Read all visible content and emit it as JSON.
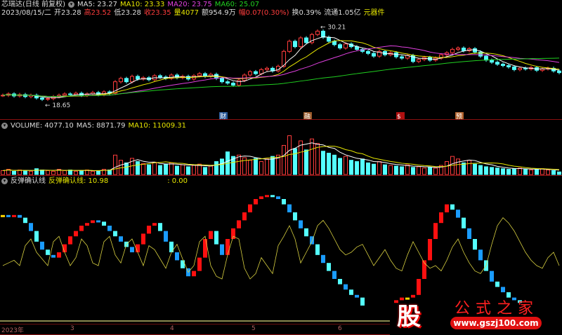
{
  "header": {
    "stock": "芯瑞达(日线 前复权)",
    "ma5": "MA5: 23.27",
    "ma10": "MA10: 23.33",
    "ma20": "MA20: 23.75",
    "ma60": "MA60: 25.07",
    "date": "2023/08/15/二",
    "open": "开23.28",
    "high": "高23.52",
    "low": "低23.28",
    "close": "收23.35",
    "volume": "量4077",
    "amount": "额954.9万",
    "change": "幅0.07(0.30%)",
    "turnover": "换0.39%",
    "float": "流通1.05亿",
    "sector": "元器件"
  },
  "price_labels": {
    "high_mark": "30.21",
    "low_mark": "18.65"
  },
  "event_markers": [
    "财",
    "融",
    "$",
    "预"
  ],
  "volume_header": {
    "volume": "VOLUME: 4077.10",
    "ma5": "MA5: 8871.79",
    "ma10": "MA10: 11009.31"
  },
  "indicator_header": {
    "name": "反弹确认线",
    "value": "反弹确认线: 10.98",
    "value2": ": 0.00"
  },
  "axis": {
    "labels": [
      "2023年",
      "3",
      "4",
      "5",
      "6"
    ]
  },
  "logo": {
    "char": "股",
    "title": "公式之家",
    "url": "www.gszj100.com"
  },
  "colors": {
    "up": "#ff3c3c",
    "down": "#54ffff",
    "ma5": "#ffffff",
    "ma10": "#e6e600",
    "ma20": "#e040e0",
    "ma60": "#20d020",
    "osc": "#d8d040"
  },
  "chart_data": {
    "type": "candlestick",
    "price_range": [
      17.5,
      31
    ],
    "close": [
      20.0,
      20.2,
      19.9,
      20.1,
      19.8,
      20.0,
      19.6,
      19.4,
      19.5,
      19.8,
      20.0,
      20.2,
      20.1,
      20.3,
      20.0,
      20.2,
      20.4,
      20.1,
      20.5,
      20.3,
      22.0,
      22.5,
      22.0,
      22.8,
      22.4,
      22.6,
      22.3,
      22.9,
      22.7,
      22.5,
      23.0,
      22.6,
      22.8,
      22.4,
      22.9,
      23.2,
      22.8,
      23.1,
      22.5,
      22.0,
      21.8,
      21.5,
      22.2,
      23.0,
      23.5,
      23.2,
      23.8,
      24.0,
      23.6,
      24.3,
      26.5,
      28.0,
      27.2,
      28.5,
      27.8,
      29.0,
      29.5,
      28.6,
      28.0,
      27.5,
      27.0,
      27.6,
      27.2,
      26.8,
      26.5,
      26.2,
      25.8,
      26.5,
      26.0,
      26.3,
      25.7,
      25.5,
      25.9,
      25.0,
      25.3,
      25.6,
      25.2,
      25.5,
      26.0,
      26.3,
      26.8,
      27.0,
      26.6,
      26.9,
      26.4,
      25.8,
      25.2,
      24.9,
      24.6,
      24.4,
      24.2,
      23.8,
      24.0,
      23.9,
      24.1,
      23.7,
      23.9,
      24.0,
      23.6,
      23.35
    ],
    "volume": [
      6,
      8,
      5,
      7,
      6,
      5,
      9,
      7,
      6,
      5,
      8,
      6,
      7,
      5,
      6,
      7,
      5,
      6,
      8,
      7,
      30,
      22,
      18,
      25,
      20,
      17,
      15,
      19,
      14,
      16,
      18,
      13,
      15,
      12,
      14,
      16,
      11,
      13,
      20,
      24,
      35,
      28,
      30,
      26,
      22,
      25,
      20,
      24,
      28,
      30,
      45,
      60,
      40,
      52,
      38,
      55,
      48,
      36,
      33,
      30,
      25,
      28,
      22,
      20,
      24,
      18,
      16,
      20,
      15,
      14,
      13,
      12,
      15,
      11,
      12,
      10,
      11,
      10,
      14,
      20,
      28,
      24,
      18,
      22,
      16,
      14,
      12,
      11,
      10,
      9,
      8,
      9,
      10,
      8,
      7,
      8,
      9,
      7,
      6,
      4
    ],
    "volume_range": [
      0,
      65
    ],
    "indicator_blocks": [
      78,
      77,
      78,
      76,
      72,
      66,
      58,
      52,
      48,
      46,
      50,
      56,
      62,
      66,
      70,
      72,
      74,
      73,
      70,
      66,
      62,
      58,
      54,
      50,
      56,
      64,
      70,
      72,
      66,
      58,
      50,
      44,
      38,
      32,
      36,
      46,
      60,
      66,
      56,
      48,
      60,
      68,
      74,
      80,
      86,
      90,
      92,
      93,
      92,
      90,
      86,
      80,
      74,
      68,
      62,
      56,
      48,
      42,
      36,
      30,
      26,
      22,
      18,
      16,
      10,
      8,
      8,
      8,
      10,
      12,
      14,
      16,
      16,
      18,
      30,
      44,
      60,
      72,
      80,
      86,
      82,
      76,
      68,
      60,
      52,
      44,
      36,
      28,
      24,
      20,
      16,
      14,
      12,
      12,
      12,
      12,
      12,
      12,
      12,
      12
    ],
    "indicator_line": [
      40,
      42,
      44,
      40,
      55,
      60,
      50,
      45,
      40,
      58,
      62,
      50,
      40,
      46,
      60,
      55,
      42,
      40,
      58,
      62,
      48,
      42,
      56,
      60,
      50,
      40,
      55,
      52,
      45,
      38,
      50,
      56,
      45,
      35,
      40,
      58,
      62,
      40,
      32,
      30,
      48,
      62,
      60,
      38,
      30,
      34,
      46,
      40,
      34,
      55,
      62,
      70,
      60,
      42,
      50,
      58,
      70,
      74,
      68,
      60,
      52,
      48,
      50,
      54,
      56,
      48,
      40,
      46,
      52,
      44,
      38,
      36,
      48,
      58,
      50,
      42,
      38,
      40,
      36,
      44,
      54,
      60,
      50,
      42,
      36,
      34,
      40,
      56,
      70,
      76,
      72,
      66,
      58,
      50,
      44,
      40,
      38,
      46,
      50,
      40
    ],
    "indicator_range": [
      0,
      100
    ]
  }
}
